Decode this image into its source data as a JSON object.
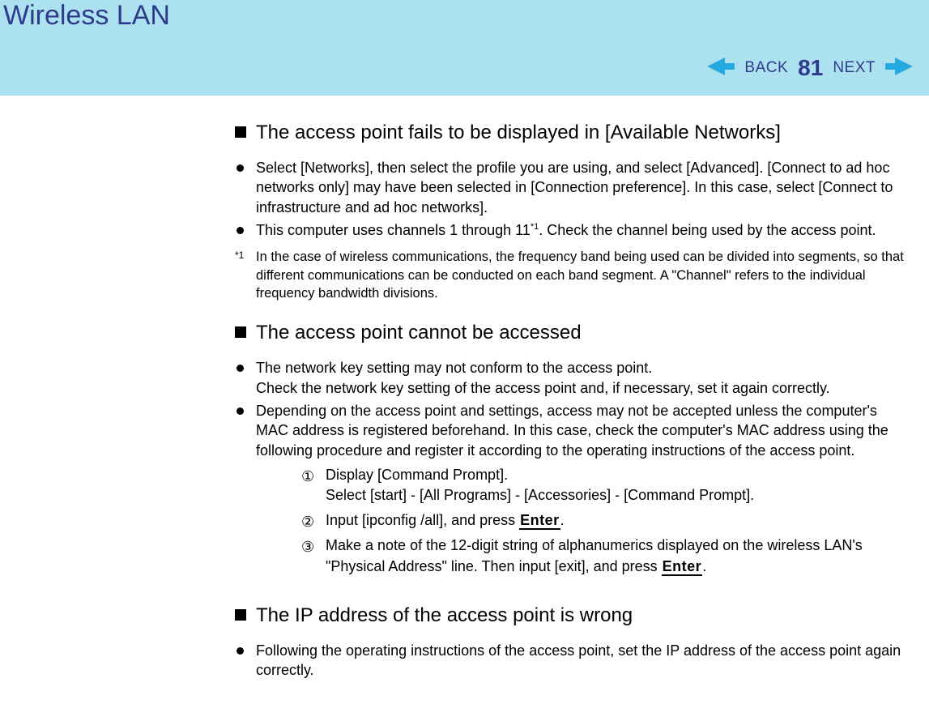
{
  "header": {
    "title": "Wireless LAN",
    "back_label": "BACK",
    "page_number": "81",
    "next_label": "NEXT"
  },
  "sections": {
    "s1": {
      "heading": "The access point fails to be displayed in [Available Networks]",
      "b1": "Select [Networks], then select the profile you are using, and select [Advanced]. [Connect to ad hoc networks only] may have been selected in [Connection preference].   In this case, select [Connect to infrastructure and ad hoc networks].",
      "b2_pre": "This computer uses channels 1 through 11",
      "b2_sup": "*1",
      "b2_post": ".  Check the channel being used by the access point.",
      "fn_marker": "*1",
      "fn_text": "In the case of wireless communications, the frequency band being used can be divided into segments, so that different communications can be conducted on each band segment.  A \"Channel\" refers to the individual frequency bandwidth divisions."
    },
    "s2": {
      "heading": "The access point cannot be accessed",
      "b1_l1": "The network key setting may not conform to the access point.",
      "b1_l2": "Check the network key setting of the access point and, if necessary, set it again correctly.",
      "b2": "Depending on the access point and settings, access may not be accepted unless the computer's MAC address is registered beforehand.   In this case, check the computer's MAC address using the following procedure and register it according to the operating instructions of the access point.",
      "step1_l1": "Display [Command Prompt].",
      "step1_l2": "Select [start] - [All Programs] - [Accessories] - [Command Prompt].",
      "step2_pre": "Input [ipconfig /all], and press ",
      "key_enter": "Enter",
      "step2_post": ".",
      "step3_pre": "Make a note of the 12-digit string of alphanumerics displayed on the wireless LAN's \"Physical Address\" line.  Then input [exit], and press ",
      "step3_post": "."
    },
    "s3": {
      "heading": "The IP address of the access point is wrong",
      "b1": "Following the operating instructions of the access point, set the IP address of the access point again correctly."
    },
    "circled": {
      "c1": "①",
      "c2": "②",
      "c3": "③"
    }
  }
}
